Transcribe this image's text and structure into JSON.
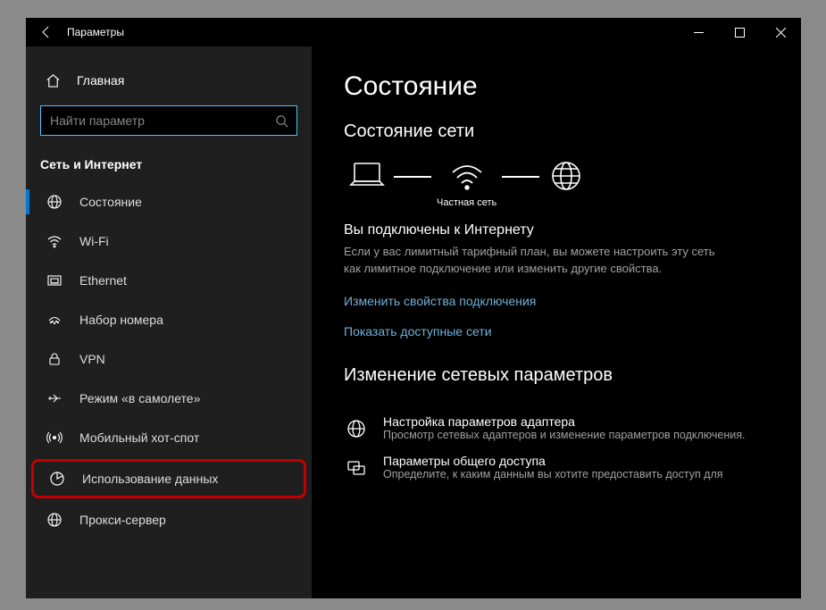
{
  "window": {
    "title": "Параметры"
  },
  "sidebar": {
    "home": "Главная",
    "search_placeholder": "Найти параметр",
    "section": "Сеть и Интернет",
    "items": [
      {
        "label": "Состояние",
        "icon": "status-icon",
        "selected": true
      },
      {
        "label": "Wi-Fi",
        "icon": "wifi-icon"
      },
      {
        "label": "Ethernet",
        "icon": "ethernet-icon"
      },
      {
        "label": "Набор номера",
        "icon": "dialup-icon"
      },
      {
        "label": "VPN",
        "icon": "vpn-icon"
      },
      {
        "label": "Режим «в самолете»",
        "icon": "airplane-icon"
      },
      {
        "label": "Мобильный хот-спот",
        "icon": "hotspot-icon"
      },
      {
        "label": "Использование данных",
        "icon": "datausage-icon",
        "highlighted": true
      },
      {
        "label": "Прокси-сервер",
        "icon": "proxy-icon"
      }
    ]
  },
  "content": {
    "title": "Состояние",
    "network_status": "Состояние сети",
    "private_network": "Частная сеть",
    "connected_headline": "Вы подключены к Интернету",
    "connected_desc": "Если у вас лимитный тарифный план, вы можете настроить эту сеть как лимитное подключение или изменить другие свойства.",
    "link_change_props": "Изменить свойства подключения",
    "link_show_networks": "Показать доступные сети",
    "change_settings_title": "Изменение сетевых параметров",
    "adapter_title": "Настройка параметров адаптера",
    "adapter_sub": "Просмотр сетевых адаптеров и изменение параметров подключения.",
    "sharing_title": "Параметры общего доступа",
    "sharing_sub": "Определите, к каким данным вы хотите предоставить доступ для"
  }
}
